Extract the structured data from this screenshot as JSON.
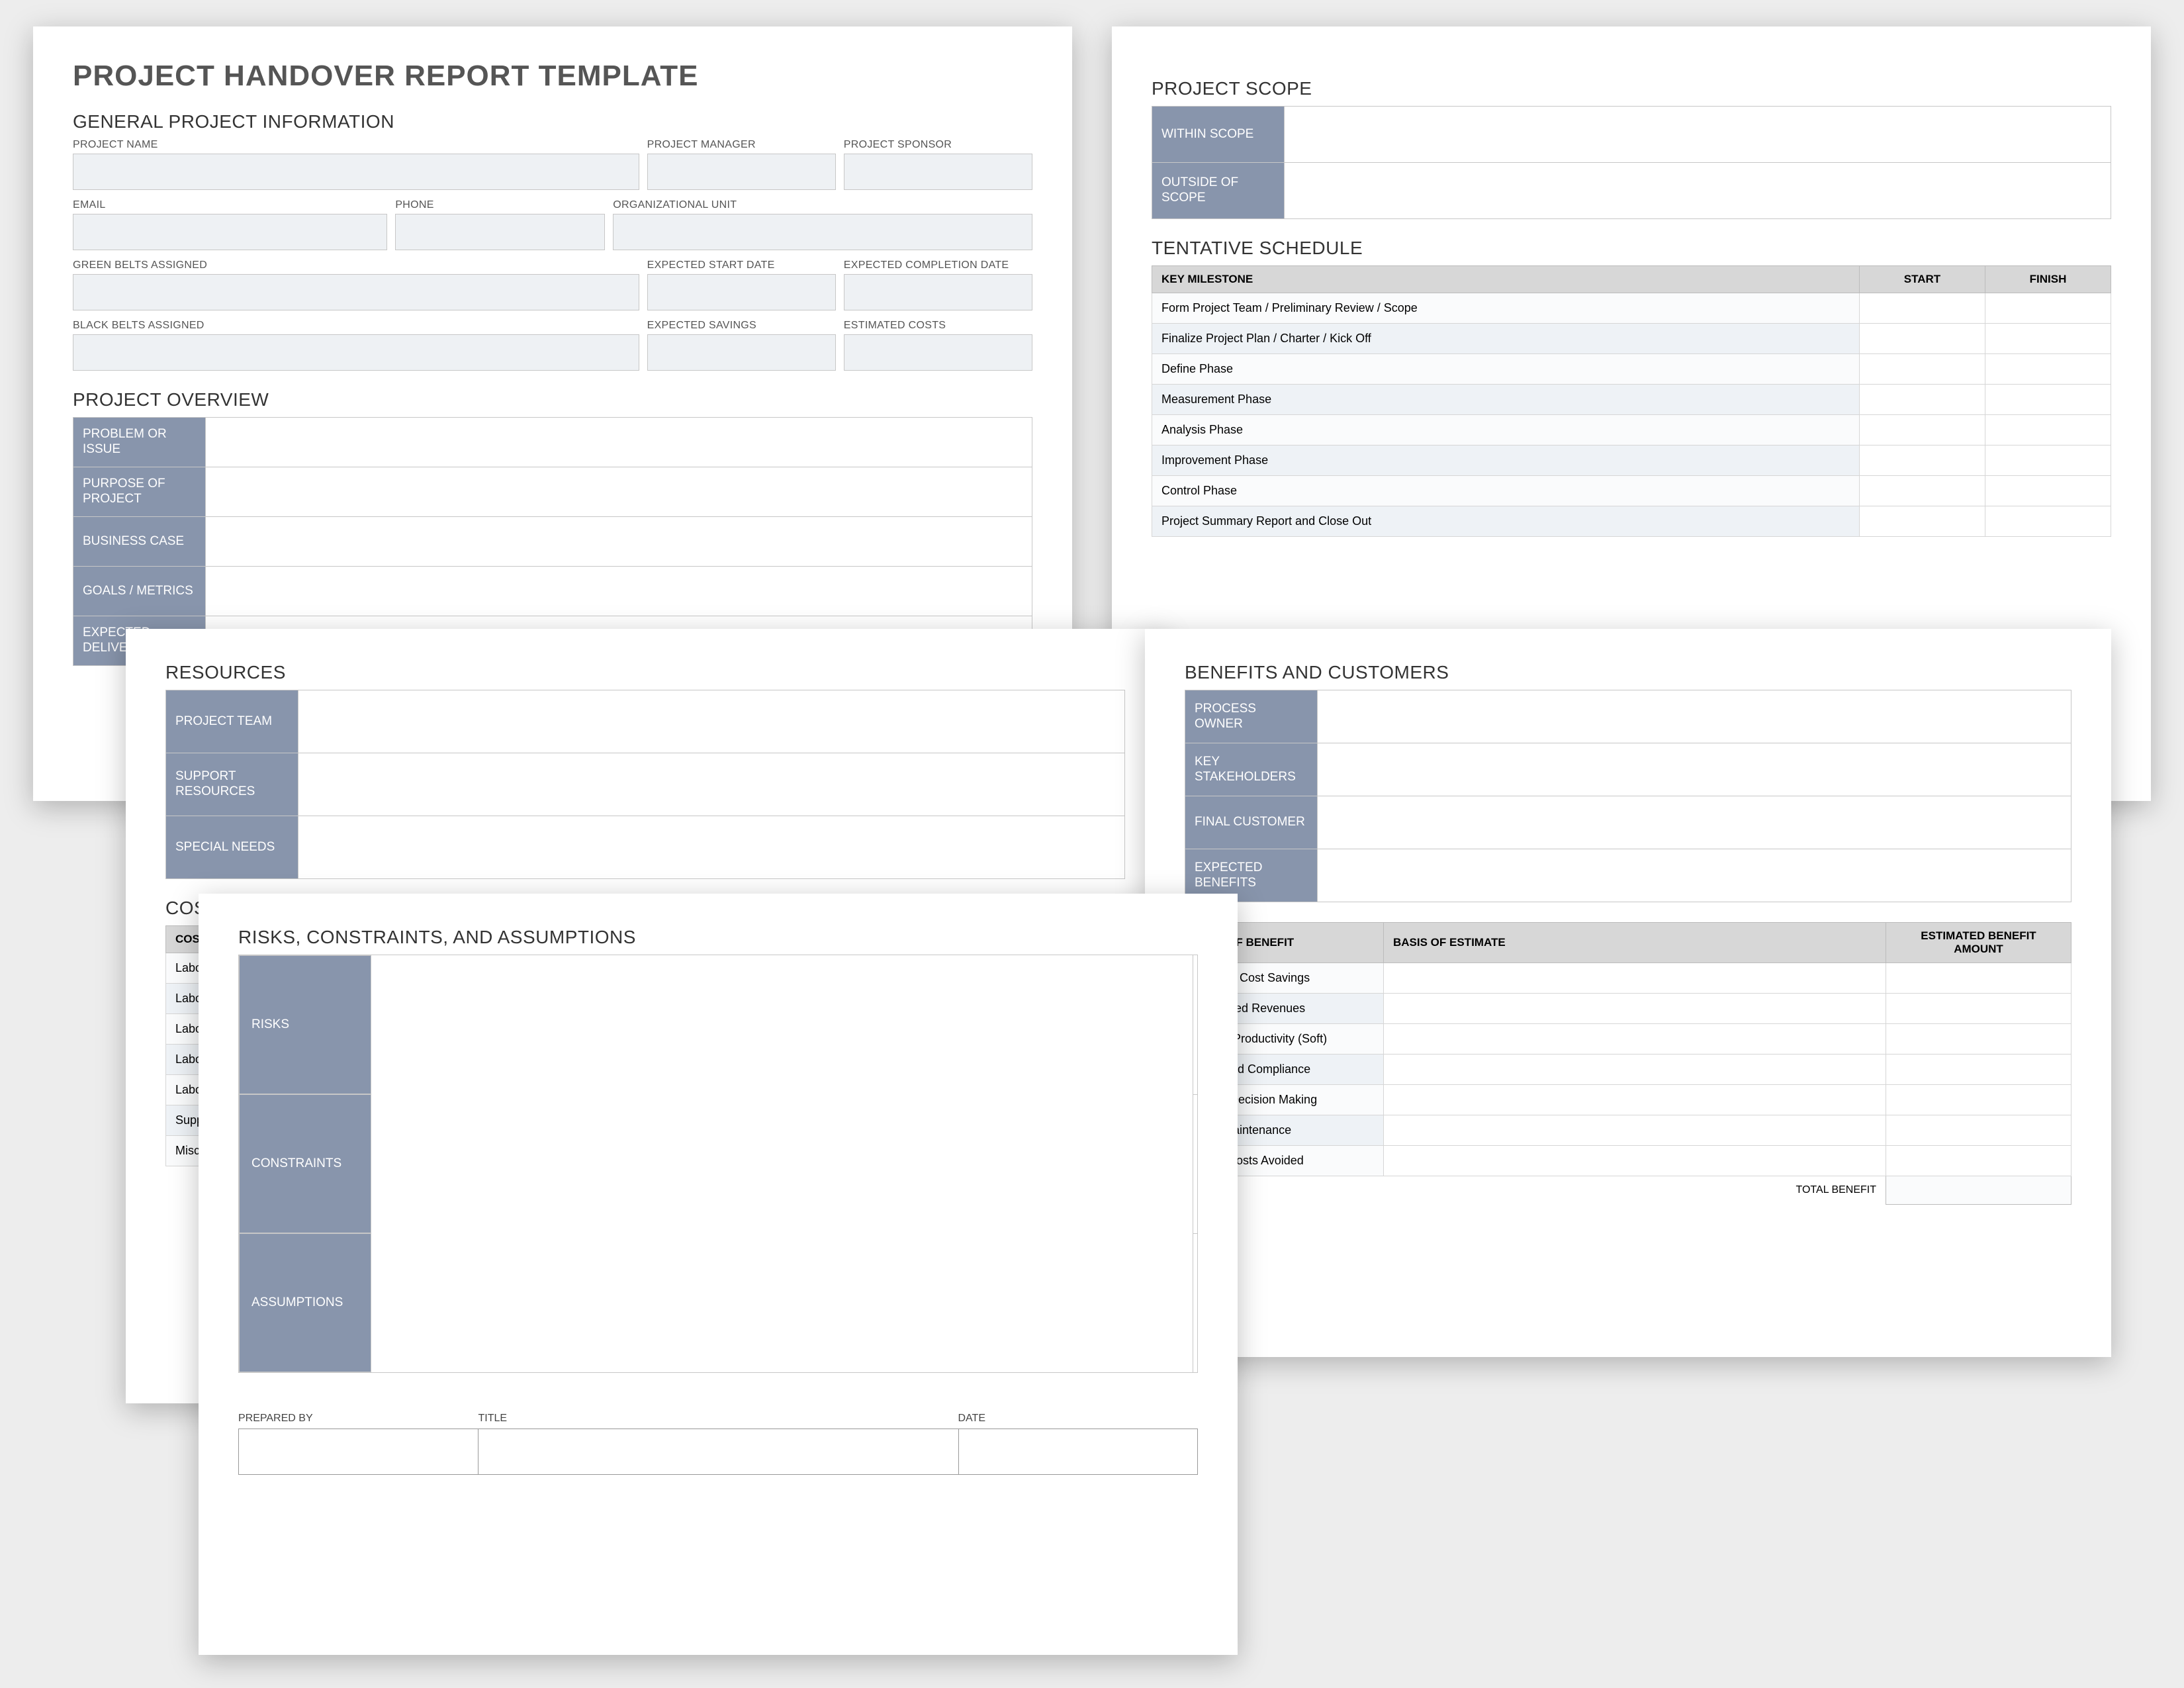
{
  "main_title": "PROJECT HANDOVER REPORT TEMPLATE",
  "sections": {
    "general_info": "GENERAL PROJECT INFORMATION",
    "overview": "PROJECT OVERVIEW",
    "scope": "PROJECT SCOPE",
    "schedule": "TENTATIVE SCHEDULE",
    "resources": "RESOURCES",
    "costs": "COSTS",
    "benefits": "BENEFITS AND CUSTOMERS",
    "risks": "RISKS, CONSTRAINTS, AND ASSUMPTIONS"
  },
  "general_fields": {
    "project_name": "PROJECT NAME",
    "project_manager": "PROJECT MANAGER",
    "project_sponsor": "PROJECT SPONSOR",
    "email": "EMAIL",
    "phone": "PHONE",
    "org_unit": "ORGANIZATIONAL UNIT",
    "green_belts": "GREEN BELTS ASSIGNED",
    "expected_start": "EXPECTED START DATE",
    "expected_completion": "EXPECTED COMPLETION DATE",
    "black_belts": "BLACK BELTS ASSIGNED",
    "expected_savings": "EXPECTED SAVINGS",
    "estimated_costs": "ESTIMATED COSTS"
  },
  "overview_rows": [
    "PROBLEM OR ISSUE",
    "PURPOSE OF PROJECT",
    "BUSINESS CASE",
    "GOALS / METRICS",
    "EXPECTED DELIVERABLES"
  ],
  "scope_rows": [
    "WITHIN SCOPE",
    "OUTSIDE OF SCOPE"
  ],
  "schedule": {
    "headers": [
      "KEY MILESTONE",
      "START",
      "FINISH"
    ],
    "rows": [
      "Form Project Team / Preliminary Review / Scope",
      "Finalize Project Plan / Charter / Kick Off",
      "Define Phase",
      "Measurement Phase",
      "Analysis Phase",
      "Improvement Phase",
      "Control Phase",
      "Project Summary Report and Close Out"
    ]
  },
  "resources_rows": [
    "PROJECT TEAM",
    "SUPPORT RESOURCES",
    "SPECIAL NEEDS"
  ],
  "costs": {
    "header": "COST TYPE",
    "rows": [
      "Labor",
      "Labor",
      "Labor",
      "Labor",
      "Labor",
      "Supplies",
      "Miscellaneous"
    ]
  },
  "benefits_rows": [
    "PROCESS OWNER",
    "KEY STAKEHOLDERS",
    "FINAL CUSTOMER",
    "EXPECTED BENEFITS"
  ],
  "benefit_table": {
    "headers": [
      "TYPE OF BENEFIT",
      "BASIS OF ESTIMATE",
      "ESTIMATED BENEFIT AMOUNT"
    ],
    "rows": [
      "Specific Cost Savings",
      "Enhanced Revenues",
      "Higher Productivity (Soft)",
      "Improved Compliance",
      "Better Decision Making",
      "Less Maintenance",
      "Other Costs Avoided"
    ],
    "total_label": "TOTAL BENEFIT"
  },
  "risks_rows": [
    "RISKS",
    "CONSTRAINTS",
    "ASSUMPTIONS"
  ],
  "signature": {
    "prepared_by": "PREPARED BY",
    "title": "TITLE",
    "date": "DATE"
  }
}
